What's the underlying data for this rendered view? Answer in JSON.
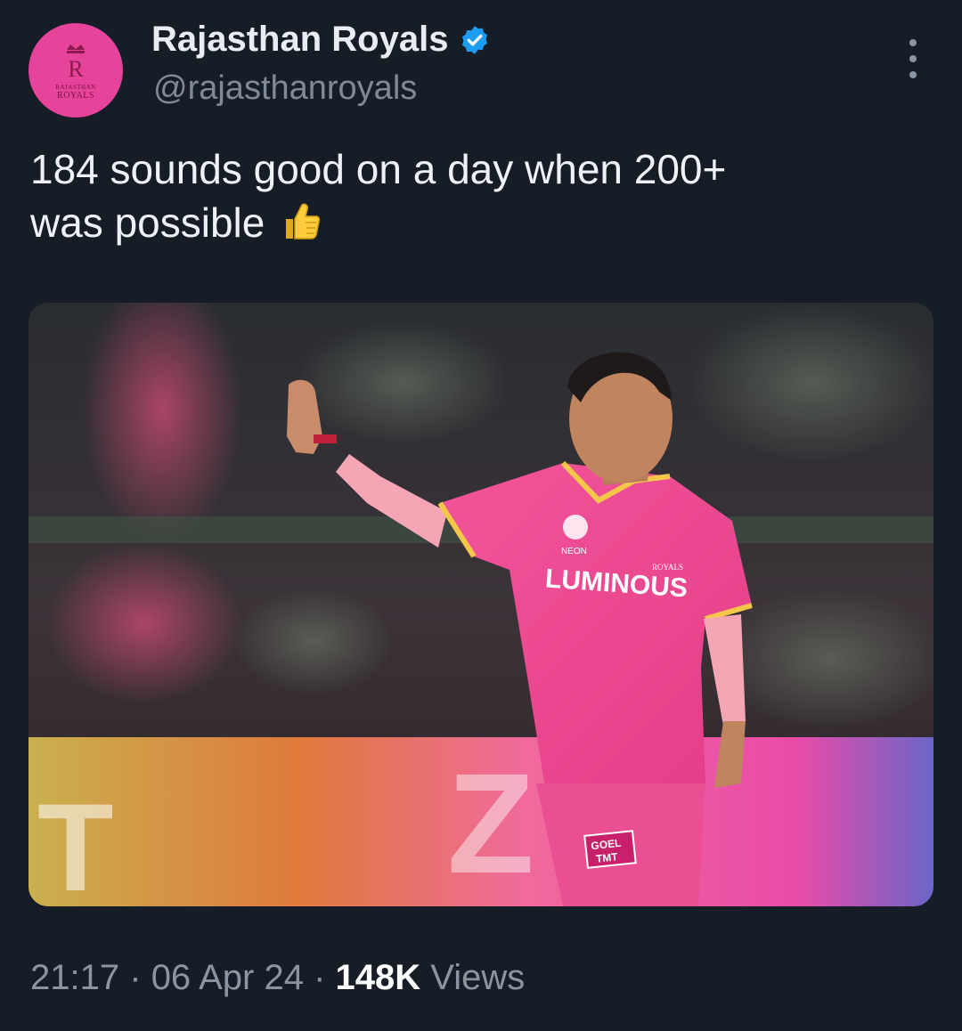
{
  "profile": {
    "display_name": "Rajasthan Royals",
    "handle": "@rajasthanroyals",
    "avatar_text_small": "RAJASTHAN",
    "avatar_text": "ROYALS",
    "verified_color": "#1d9bf0",
    "avatar_color": "#e6439a"
  },
  "tweet": {
    "text_line1": "184 sounds good on a day when 200+",
    "text_line2": "was possible",
    "emoji": "thumbs-up"
  },
  "media": {
    "jersey_text": "LUMINOUS",
    "jersey_sponsor_small": "NEON",
    "shorts_text_1": "GOEL",
    "shorts_text_2": "TMT",
    "crest_text": "ROYALS"
  },
  "meta": {
    "time": "21:17",
    "separator": "·",
    "date": "06 Apr 24",
    "views_count": "148K",
    "views_label": "Views"
  }
}
